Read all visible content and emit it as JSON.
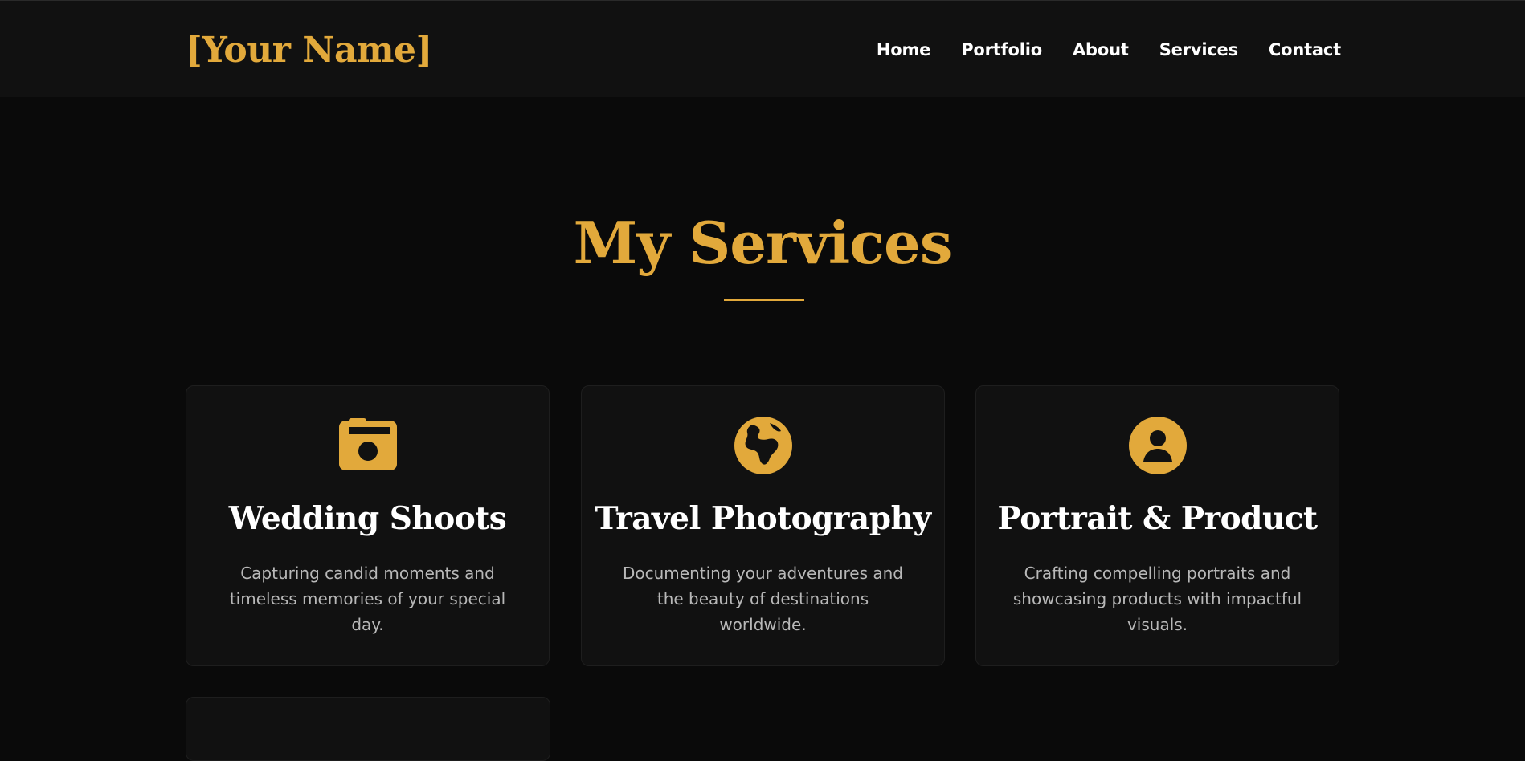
{
  "header": {
    "logo": "[Your Name]",
    "nav": [
      {
        "label": "Home"
      },
      {
        "label": "Portfolio"
      },
      {
        "label": "About"
      },
      {
        "label": "Services"
      },
      {
        "label": "Contact"
      }
    ]
  },
  "services": {
    "title": "My Services",
    "cards": [
      {
        "icon": "camera-icon",
        "title": "Wedding Shoots",
        "description": "Capturing candid moments and timeless memories of your special day."
      },
      {
        "icon": "globe-icon",
        "title": "Travel Photography",
        "description": "Documenting your adventures and the beauty of destinations worldwide."
      },
      {
        "icon": "user-circle-icon",
        "title": "Portrait & Product",
        "description": "Crafting compelling portraits and showcasing products with impactful visuals."
      }
    ]
  },
  "colors": {
    "accent": "#e2a93b",
    "background": "#0a0a0a",
    "header_bg": "#111111",
    "card_bg": "#111111",
    "text_primary": "#ffffff",
    "text_muted": "#b8b8b8"
  }
}
